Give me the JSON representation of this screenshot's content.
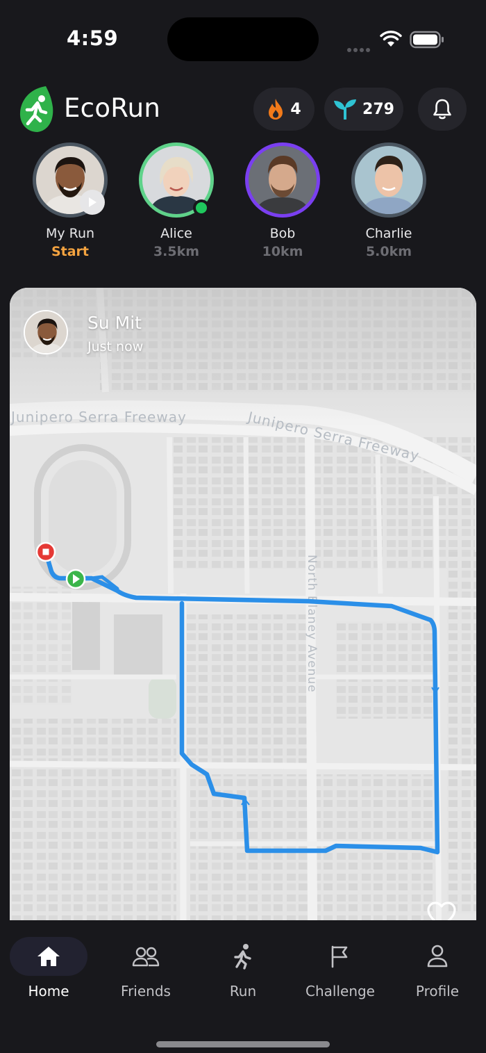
{
  "status_bar": {
    "time": "4:59"
  },
  "header": {
    "app_title": "EcoRun",
    "streak_count": "4",
    "eco_points": "279"
  },
  "friends": [
    {
      "name": "My Run",
      "sub": "Start",
      "ring_color": "#4a5560"
    },
    {
      "name": "Alice",
      "sub": "3.5km",
      "ring_color": "#5fd28a"
    },
    {
      "name": "Bob",
      "sub": "10km",
      "ring_color": "#7a3ff0"
    },
    {
      "name": "Charlie",
      "sub": "5.0km",
      "ring_color": "#4a5560"
    }
  ],
  "feed": {
    "user_name": "Su Mit",
    "time_ago": "Just now",
    "map_labels": {
      "freeway_left": "Junipero Serra Freeway",
      "freeway_right": "Junipero Serra Freeway",
      "avenue": "North Blaney Avenue"
    }
  },
  "nav": {
    "items": [
      {
        "label": "Home",
        "icon": "home-icon"
      },
      {
        "label": "Friends",
        "icon": "friends-icon"
      },
      {
        "label": "Run",
        "icon": "run-icon"
      },
      {
        "label": "Challenge",
        "icon": "flag-icon"
      },
      {
        "label": "Profile",
        "icon": "profile-icon"
      }
    ],
    "active": "Home"
  },
  "colors": {
    "background": "#18181c",
    "accent_orange": "#f4a340",
    "route_blue": "#2b8fe8",
    "leaf_teal": "#2fc3d3",
    "brand_green": "#2fb24a"
  }
}
